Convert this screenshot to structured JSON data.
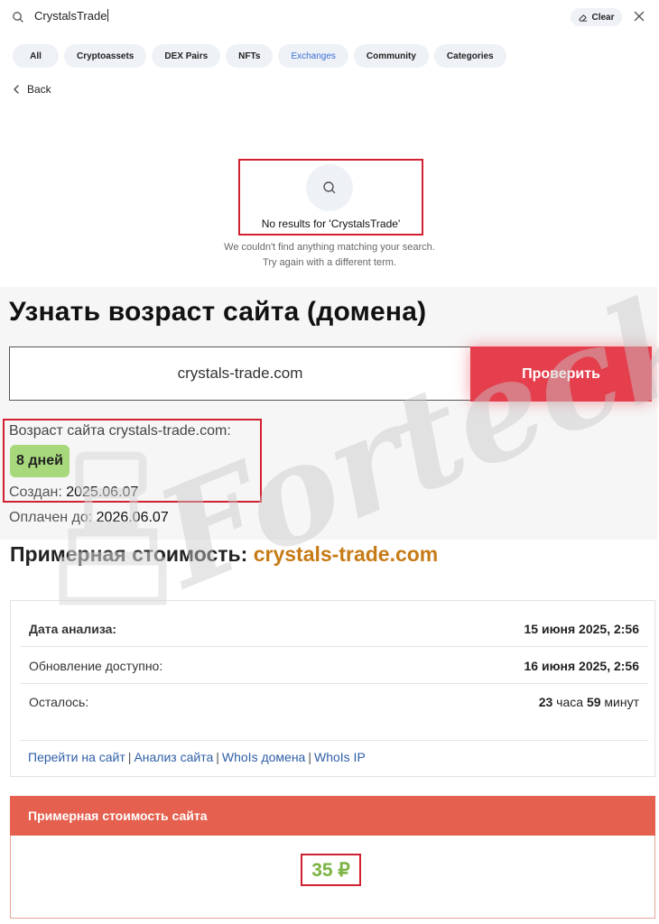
{
  "search": {
    "query": "CrystalsTrade",
    "clear_label": "Clear"
  },
  "filters": [
    {
      "label": "All",
      "active": false
    },
    {
      "label": "Cryptoassets",
      "active": false
    },
    {
      "label": "DEX Pairs",
      "active": false
    },
    {
      "label": "NFTs",
      "active": false
    },
    {
      "label": "Exchanges",
      "active": true
    },
    {
      "label": "Community",
      "active": false
    },
    {
      "label": "Categories",
      "active": false
    }
  ],
  "back_label": "Back",
  "no_results": {
    "title": "No results for 'CrystalsTrade'",
    "line1": "We couldn't find anything matching your search.",
    "line2": "Try again with a different term."
  },
  "domain_age": {
    "title": "Узнать возраст сайта (домена)",
    "input_value": "crystals-trade.com",
    "check_button": "Проверить",
    "age_label": "Возраст сайта crystals-trade.com:",
    "age_value": "8 дней",
    "created_label": "Создан:",
    "created_value": "2025.06.07",
    "paid_label": "Оплачен до:",
    "paid_value": "2026.06.07"
  },
  "estimate": {
    "heading_prefix": "Примерная стоимость:",
    "heading_domain": "crystals-trade.com",
    "rows": [
      {
        "label": "Дата анализа:",
        "value": "15 июня 2025, 2:56"
      },
      {
        "label": "Обновление доступно:",
        "value": "16 июня 2025, 2:56"
      },
      {
        "label": "Осталось:",
        "hours": "23",
        "hours_unit": "часа",
        "minutes": "59",
        "minutes_unit": "минут"
      }
    ],
    "links": [
      "Перейти на сайт",
      "Анализ сайта",
      "WhoIs домена",
      "WhoIs IP"
    ],
    "price_header": "Примерная стоимость сайта",
    "price_value": "35 ₽"
  },
  "watermark_text": "Forteck",
  "colors": {
    "accent_red": "#e53e4d",
    "highlight_box": "#d1202f",
    "badge_green": "#a7d97c",
    "domain_orange": "#c77b16",
    "link_blue": "#2f5fa7",
    "price_header": "#e5604f",
    "price_green": "#7cb342",
    "active_chip": "#3a6fd8"
  },
  "icons": [
    "search-icon",
    "eraser-icon",
    "close-icon",
    "chevron-left-icon",
    "magnifier-icon"
  ]
}
